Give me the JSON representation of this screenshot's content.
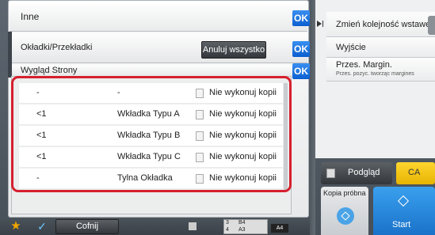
{
  "header": {
    "title": "Inne",
    "ok_label": "OK"
  },
  "sections": {
    "covers_label": "Okładki/Przekładki",
    "cancel_all_label": "Anuluj wszystko",
    "page_look_label": "Wygląd Strony",
    "ok_label": "OK"
  },
  "inserts": [
    {
      "page": "-",
      "type": "-",
      "action": "Nie wykonuj kopii"
    },
    {
      "page": "<1",
      "type": "Wkładka Typu A",
      "action": "Nie wykonuj kopii"
    },
    {
      "page": "<1",
      "type": "Wkładka Typu B",
      "action": "Nie wykonuj kopii"
    },
    {
      "page": "<1",
      "type": "Wkładka Typu C",
      "action": "Nie wykonuj kopii"
    },
    {
      "page": "-",
      "type": "Tylna Okładka",
      "action": "Nie wykonuj kopii"
    }
  ],
  "right_menu": {
    "change_order": "Zmień kolejność wstawek",
    "exit": "Wyjście",
    "margin_title": "Przes. Margin.",
    "margin_sub": "Przes. pozyc. tworząc margines",
    "preview": "Podgląd",
    "ca": "CA",
    "sample": "Kopia próbna",
    "start": "Start"
  },
  "bottom_bar": {
    "back": "Cofnij",
    "tray_nums": [
      "3",
      "4"
    ],
    "tray_sizes": [
      "B4",
      "A3"
    ],
    "paper": "A4"
  },
  "colors": {
    "highlight": "#d6202e",
    "ok_blue": "#0b5fd0",
    "ca_yellow": "#f2c200",
    "start_blue": "#2a8fe0"
  }
}
